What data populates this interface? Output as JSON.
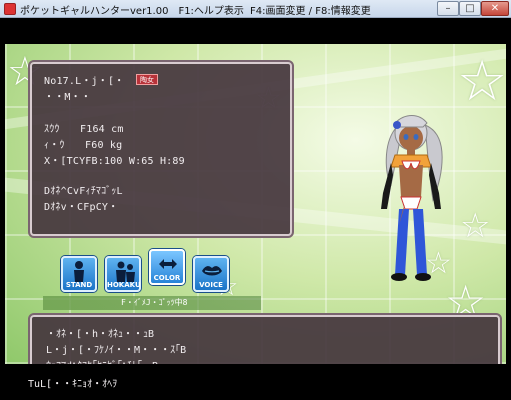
{
  "window": {
    "title": "ポケットギャルハンターver1.00　F1:ヘルプ表示",
    "menu_hint": "F4:画面変更 / F8:情報変更",
    "min_symbol": "–",
    "max_symbol": "□",
    "close_symbol": "✕"
  },
  "info": {
    "line1": "No17.L・j・[・",
    "tag": "陶女",
    "line2": "・・M・・",
    "line3": "ｽｳｳ　　F164 cm",
    "line4": "ｨ・ｳ　　F60 kg",
    "line5": "X・[TCYFB:100 W:65 H:89",
    "line6": "Dｵﾈ^CvFｨﾁﾏｺﾞｯL",
    "line7": "Dｵﾈv・CFpCY・"
  },
  "buttons": {
    "stand": "STAND",
    "hokaku": "HOKAKU",
    "color": "COLOR",
    "voice": "VOICE"
  },
  "hint": "F・ｲﾞﾒJ・ｺﾟｯﾂ中8",
  "message": {
    "line1": "・ｵﾈ・[・h・ｵﾈｭ・・ｭB",
    "line2": "L・j・[・ﾌｹﾉｲ・・M・・・ｽ｢B",
    "line3": "ｳｪﾌﾏdﾍｸﾌｹ｢ｾﾆｾﾞ｢ﾍﾁﾄ｢・B"
  },
  "bottom": "TuL[・・ｷﾆｮｵ・ｵﾍｦ",
  "colors": {
    "panel": "#46373e",
    "button": "#1b74c8",
    "bg_green": "#8fc86a"
  }
}
